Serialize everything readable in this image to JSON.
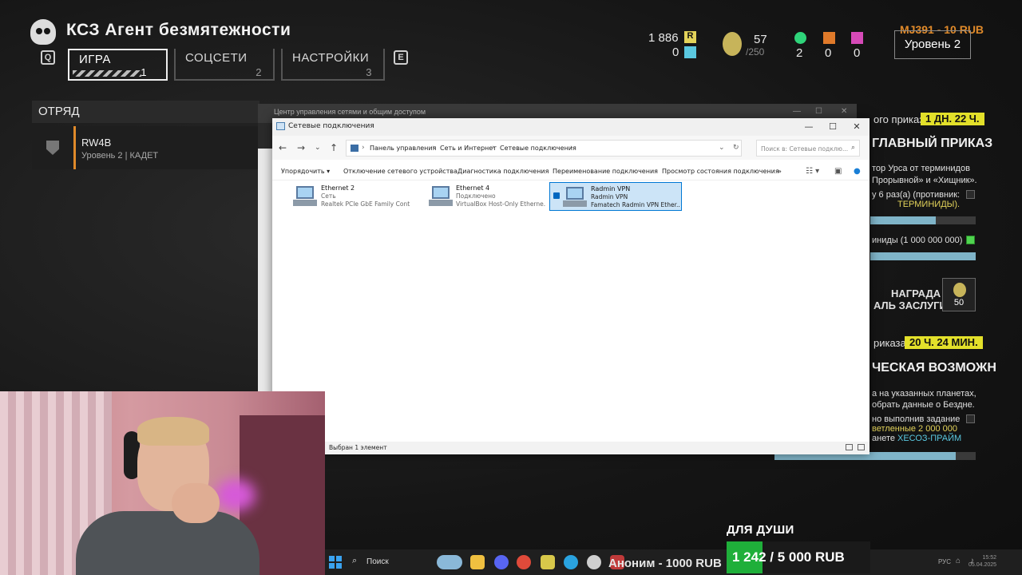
{
  "game": {
    "title": "КСЗ Агент безмятежности",
    "key_left": "Q",
    "key_right": "E",
    "tabs": [
      {
        "label": "ИГРА",
        "num": "1"
      },
      {
        "label": "СОЦСЕТИ",
        "num": "2"
      },
      {
        "label": "НАСТРОЙКИ",
        "num": "3"
      }
    ],
    "squad_header": "ОТРЯД",
    "squad_member": {
      "name": "RW4B",
      "sub": "Уровень 2 | КАДЕТ"
    },
    "currency": {
      "r_value": "1 886",
      "r_badge": "R",
      "s_value": "0",
      "medals": "57",
      "medals_max": "/250"
    },
    "samples": [
      {
        "value": "2",
        "color": "#2fd47a"
      },
      {
        "value": "0",
        "color": "#e07a2a"
      },
      {
        "value": "0",
        "color": "#d64ab8"
      }
    ],
    "donation_top": "MJ391 - 10 RUB",
    "level": "Уровень 2",
    "orders": {
      "minor_label": "ого приказа:",
      "minor_time": "1 ДН. 22 Ч.",
      "major_title": "ГЛАВНЫЙ ПРИКАЗ",
      "major_desc1": "тор Урса от терминидов",
      "major_desc2": "Прорывной» и «Хищник».",
      "task1_a": "у 6 раз(а) (противник:",
      "task1_b": "ТЕРМИНИДЫ).",
      "task1_progress": 0.62,
      "task2_label": "иниды (1 000 000 000)",
      "task2_progress": 1.0,
      "reward_label": "НАГРАДА",
      "reward_sub": "АЛЬ ЗАСЛУГИ",
      "reward_value": "50",
      "next_label": "риказа:",
      "next_time": "20 Ч. 24 МИН.",
      "opp_title": "ЧЕСКАЯ ВОЗМОЖН",
      "opp1": "а на указанных планетах,",
      "opp2": "обрать данные о Бездне.",
      "opp3": "но выполнив задание",
      "opp4": "ветленные 2 000 000",
      "opp5a": "анете",
      "opp5b": "ХЕСОЗ-ПРАЙМ",
      "opp_progress": 0.9
    }
  },
  "bg_window": {
    "title": "Центр управления сетями и общим доступом"
  },
  "explorer": {
    "title": "Сетевые подключения",
    "breadcrumb": [
      "Панель управления",
      "Сеть и Интернет",
      "Сетевые подключения"
    ],
    "search_placeholder": "Поиск в: Сетевые подклю...",
    "toolbar": {
      "organize": "Упорядочить",
      "disable": "Отключение сетевого устройства",
      "diagnose": "Диагностика подключения",
      "rename": "Переименование подключения",
      "status": "Просмотр состояния подключения",
      "more": "»"
    },
    "items": [
      {
        "name": "Ethernet 2",
        "status": "Сеть",
        "device": "Realtek PCIe GbE Family Cont..."
      },
      {
        "name": "Ethernet 4",
        "status": "Подключено",
        "device": "VirtualBox Host-Only Etherne..."
      },
      {
        "name": "Radmin VPN",
        "status": "Radmin VPN",
        "device": "Famatech Radmin VPN Ether..."
      }
    ],
    "status_text": "Выбран 1 элемент"
  },
  "taskbar": {
    "search_label": "Поиск",
    "lang": "РУС",
    "time": "15:52",
    "date": "05.04.2025",
    "apps": [
      {
        "name": "folder-icon",
        "color": "#f0c040"
      },
      {
        "name": "discord-icon",
        "color": "#5865f2"
      },
      {
        "name": "chrome-icon",
        "color": "#e04a3a"
      },
      {
        "name": "game-icon",
        "color": "#d8c84a"
      },
      {
        "name": "telegram-icon",
        "color": "#2aa3e0"
      },
      {
        "name": "steam-icon",
        "color": "#cfcfcf"
      },
      {
        "name": "record-icon",
        "color": "#c03a3a"
      }
    ]
  },
  "overlay": {
    "anon": "Аноним - 1000 RUB",
    "dusha": "ДЛЯ ДУШИ",
    "goal_text": "1 242 / 5 000 RUB",
    "goal_progress": 0.2484
  }
}
